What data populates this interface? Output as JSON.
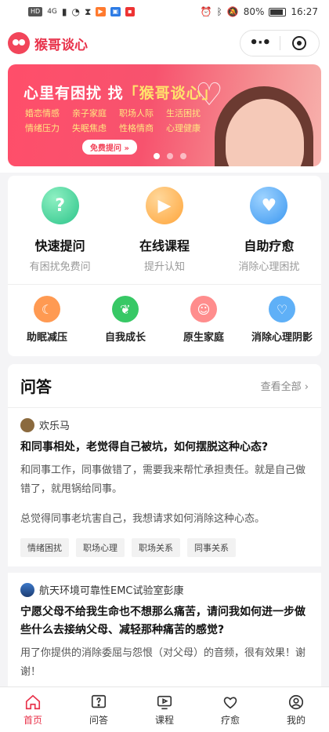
{
  "status_bar": {
    "left_badges": [
      "HD",
      "4G"
    ],
    "battery": "80%",
    "time": "16:27"
  },
  "header": {
    "brand": "猴哥谈心",
    "menu_icon": "more-dots-icon",
    "close_icon": "target-icon"
  },
  "banner": {
    "title_main": "心里有困扰 找",
    "title_highlight": "「猴哥谈心」",
    "tags": [
      "婚恋情感",
      "亲子家庭",
      "职场人际",
      "生活困扰",
      "情绪压力",
      "失眠焦虑",
      "性格情商",
      "心理健康"
    ],
    "button": "免费提问 »",
    "slides": 3,
    "active_slide": 0
  },
  "services": [
    {
      "title": "快速提问",
      "subtitle": "有困扰免费问",
      "icon": "question-chat-icon",
      "color": "#2cc48a"
    },
    {
      "title": "在线课程",
      "subtitle": "提升认知",
      "icon": "video-play-icon",
      "color": "#ffa53a"
    },
    {
      "title": "自助疗愈",
      "subtitle": "消除心理困扰",
      "icon": "heart-icon",
      "color": "#3b97f0"
    }
  ],
  "mini_services": [
    {
      "label": "助眠减压",
      "icon": "moon-icon",
      "color": "#ff9a52"
    },
    {
      "label": "自我成长",
      "icon": "sprout-icon",
      "color": "#37c865"
    },
    {
      "label": "原生家庭",
      "icon": "family-icon",
      "color": "#ff8d8d"
    },
    {
      "label": "消除心理阴影",
      "icon": "hand-heart-icon",
      "color": "#5fb0f7"
    }
  ],
  "qa": {
    "title": "问答",
    "more": "查看全部 ›",
    "items": [
      {
        "user": "欢乐马",
        "question": "和同事相处，老觉得自己被坑，如何摆脱这种心态?",
        "body1": "和同事工作，同事做错了，需要我来帮忙承担责任。就是自己做错了，就甩锅给同事。",
        "body2": "总觉得同事老坑害自己，我想请求如何消除这种心态。",
        "tags": [
          "情绪困扰",
          "职场心理",
          "职场关系",
          "同事关系"
        ]
      },
      {
        "user": "航天环境可靠性EMC试验室彭康",
        "question": "宁愿父母不给我生命也不想那么痛苦，请问我如何进一步做些什么去接纳父母、减轻那种痛苦的感觉?",
        "body1": "用了你提供的消除委屈与怨恨（对父母）的音频，很有效果！谢谢！"
      }
    ]
  },
  "tabbar": [
    {
      "label": "首页",
      "icon": "home-icon",
      "active": true
    },
    {
      "label": "问答",
      "icon": "question-box-icon",
      "active": false
    },
    {
      "label": "课程",
      "icon": "video-icon",
      "active": false
    },
    {
      "label": "疗愈",
      "icon": "heart-outline-icon",
      "active": false
    },
    {
      "label": "我的",
      "icon": "user-icon",
      "active": false
    }
  ]
}
